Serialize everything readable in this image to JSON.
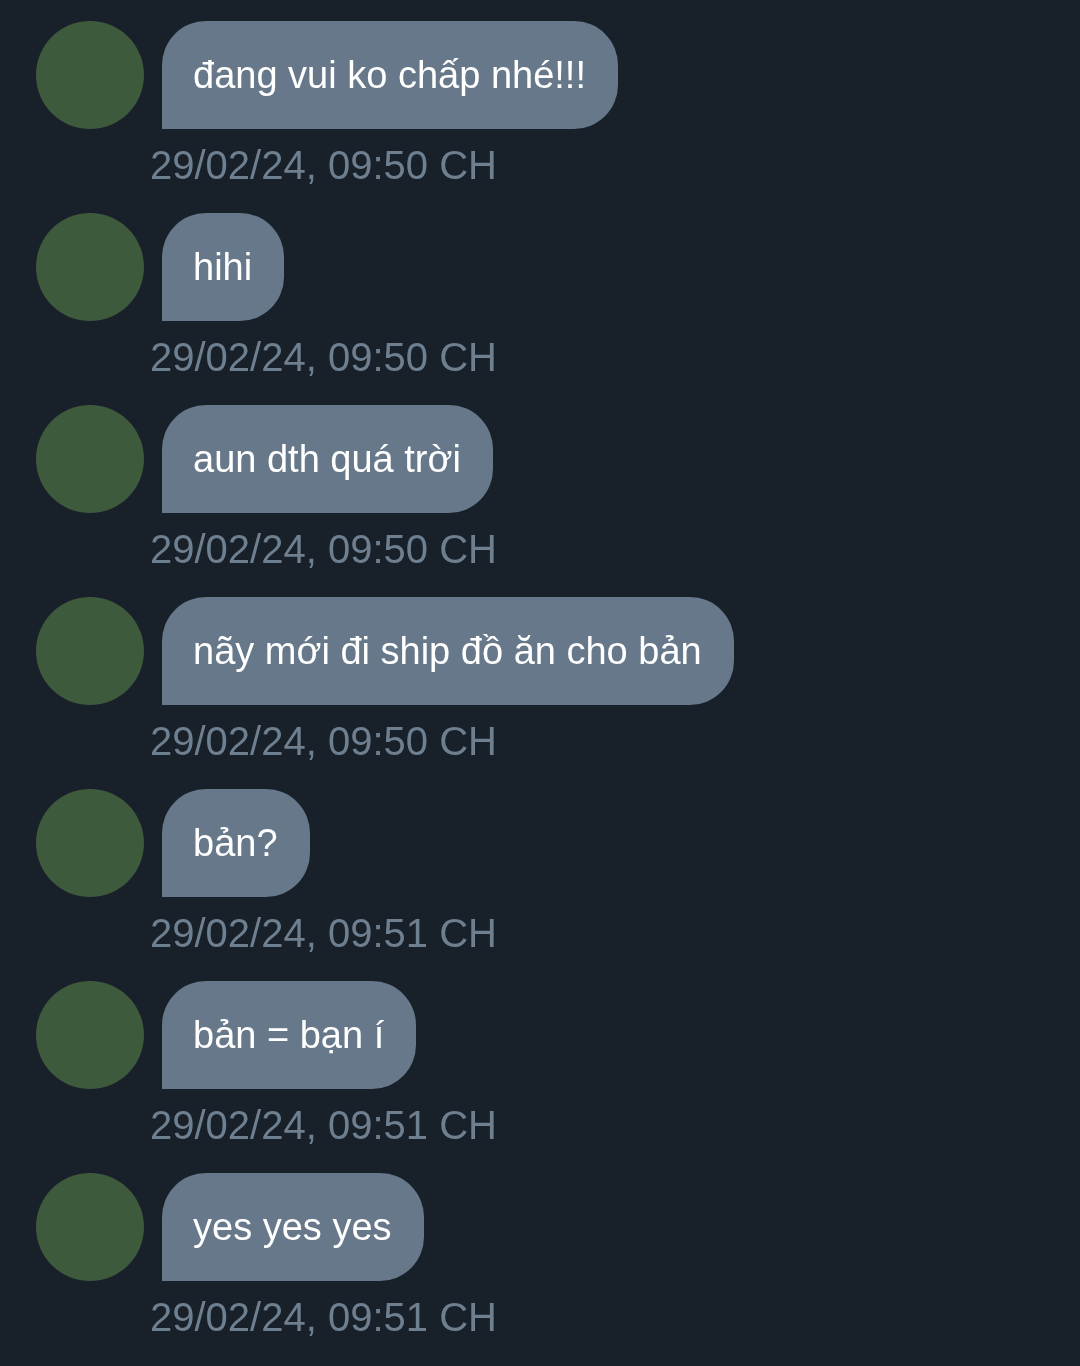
{
  "messages": [
    {
      "text": "đang vui ko chấp nhé!!!",
      "time": "29/02/24, 09:50 CH"
    },
    {
      "text": "hihi",
      "time": "29/02/24, 09:50 CH"
    },
    {
      "text": "aun dth quá trời",
      "time": "29/02/24, 09:50 CH"
    },
    {
      "text": "nãy mới đi ship đồ ăn cho bản",
      "time": "29/02/24, 09:50 CH"
    },
    {
      "text": "bản?",
      "time": "29/02/24, 09:51 CH"
    },
    {
      "text": "bản = bạn í",
      "time": "29/02/24, 09:51 CH"
    },
    {
      "text": "yes yes yes",
      "time": "29/02/24, 09:51 CH"
    }
  ]
}
